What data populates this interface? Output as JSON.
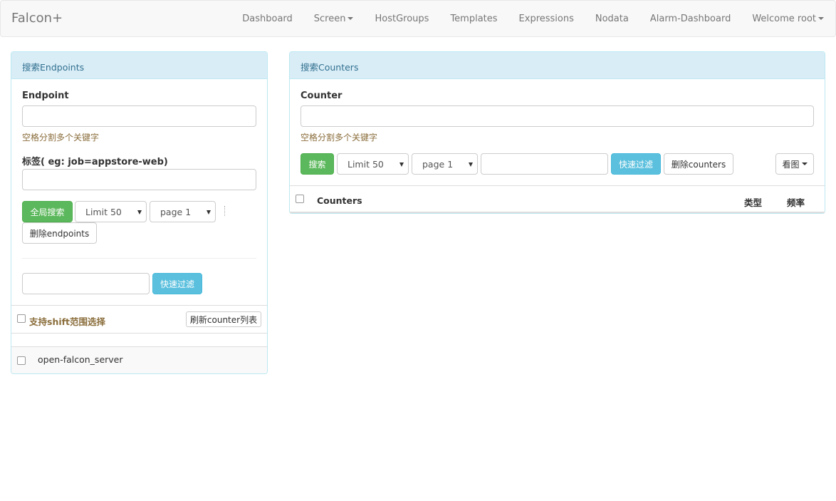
{
  "navbar": {
    "brand": "Falcon+",
    "items": [
      {
        "label": "Dashboard",
        "dropdown": false
      },
      {
        "label": "Screen",
        "dropdown": true
      },
      {
        "label": "HostGroups",
        "dropdown": false
      },
      {
        "label": "Templates",
        "dropdown": false
      },
      {
        "label": "Expressions",
        "dropdown": false
      },
      {
        "label": "Nodata",
        "dropdown": false
      },
      {
        "label": "Alarm-Dashboard",
        "dropdown": false
      },
      {
        "label": "Welcome root",
        "dropdown": true
      }
    ]
  },
  "endpoints_panel": {
    "heading": "搜索Endpoints",
    "endpoint_label": "Endpoint",
    "endpoint_value": "",
    "endpoint_help": "空格分割多个关键字",
    "tag_label": "标签( eg: job=appstore-web)",
    "tag_value": "",
    "search_button": "全局搜索",
    "limit_select": "Limit 50",
    "page_select": "page 1",
    "delete_button": "删除endpoints",
    "filter_value": "",
    "filter_button": "快速过滤",
    "shift_select_label": "支持shift范围选择",
    "refresh_button": "刷新counter列表",
    "endpoints": [
      {
        "name": "open-falcon_server",
        "checked": false
      }
    ]
  },
  "counters_panel": {
    "heading": "搜索Counters",
    "counter_label": "Counter",
    "counter_value": "",
    "counter_help": "空格分割多个关键字",
    "search_button": "搜索",
    "limit_select": "Limit 50",
    "page_select": "page 1",
    "filter_value": "",
    "filter_button": "快速过滤",
    "delete_button": "删除counters",
    "view_button": "看图",
    "table": {
      "columns": [
        "Counters",
        "类型",
        "频率"
      ]
    }
  },
  "colors": {
    "panel_border": "#bce8f1",
    "panel_heading_bg": "#d9edf7",
    "success": "#5cb85c",
    "info": "#5bc0de",
    "help_text": "#8a6d3b"
  }
}
